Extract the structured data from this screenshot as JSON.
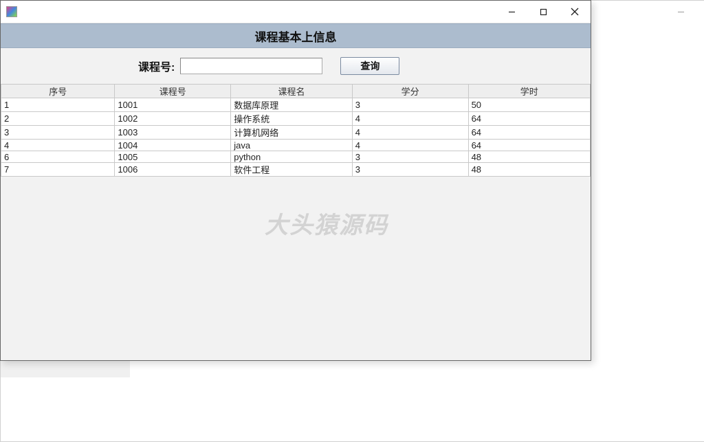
{
  "header": {
    "title": "课程基本上信息"
  },
  "search": {
    "label": "课程号:",
    "value": "",
    "button": "查询"
  },
  "table": {
    "columns": [
      "序号",
      "课程号",
      "课程名",
      "学分",
      "学时"
    ],
    "rows": [
      {
        "seq": "1",
        "cid": "1001",
        "cname": "数据库原理",
        "credit": "3",
        "hours": "50"
      },
      {
        "seq": "2",
        "cid": "1002",
        "cname": "操作系统",
        "credit": "4",
        "hours": "64"
      },
      {
        "seq": "3",
        "cid": "1003",
        "cname": "计算机网络",
        "credit": "4",
        "hours": "64"
      },
      {
        "seq": "4",
        "cid": "1004",
        "cname": "java",
        "credit": "4",
        "hours": "64"
      },
      {
        "seq": "6",
        "cid": "1005",
        "cname": "python",
        "credit": "3",
        "hours": "48"
      },
      {
        "seq": "7",
        "cid": "1006",
        "cname": "软件工程",
        "credit": "3",
        "hours": "48"
      }
    ]
  },
  "watermark": "大头猿源码"
}
